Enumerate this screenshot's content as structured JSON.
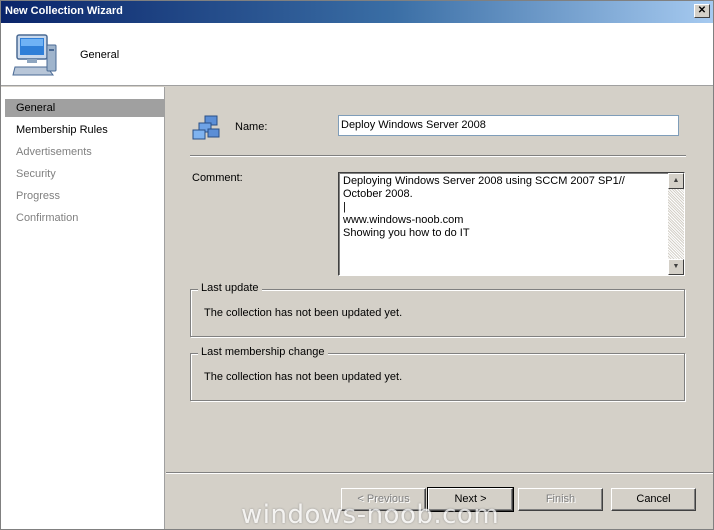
{
  "window": {
    "title": "New Collection Wizard",
    "close_glyph": "✕"
  },
  "header": {
    "title": "General",
    "icon": "computer-icon"
  },
  "nav": {
    "items": [
      {
        "label": "General",
        "state": "active"
      },
      {
        "label": "Membership Rules",
        "state": "enabled"
      },
      {
        "label": "Advertisements",
        "state": "disabled"
      },
      {
        "label": "Security",
        "state": "disabled"
      },
      {
        "label": "Progress",
        "state": "disabled"
      },
      {
        "label": "Confirmation",
        "state": "disabled"
      }
    ]
  },
  "form": {
    "name_label": "Name:",
    "name_value": "Deploy Windows Server 2008",
    "name_icon": "collection-icon",
    "comment_label": "Comment:",
    "comment_lines": [
      "Deploying Windows Server 2008 using SCCM 2007 SP1//",
      "October 2008.",
      "|",
      "www.windows-noob.com",
      "Showing you how to do IT"
    ]
  },
  "last_update": {
    "legend": "Last update",
    "text": "The collection has not been updated yet."
  },
  "last_membership_change": {
    "legend": "Last membership change",
    "text": "The collection has not been updated yet."
  },
  "buttons": {
    "previous": "< Previous",
    "next": "Next >",
    "finish": "Finish",
    "cancel": "Cancel"
  },
  "watermark": "windows-noob.com",
  "colors": {
    "title_bar_start": "#0a246a",
    "title_bar_end": "#a6caf0",
    "nav_active": "#a0a0a0",
    "dialog_face": "#d4d0c8"
  }
}
